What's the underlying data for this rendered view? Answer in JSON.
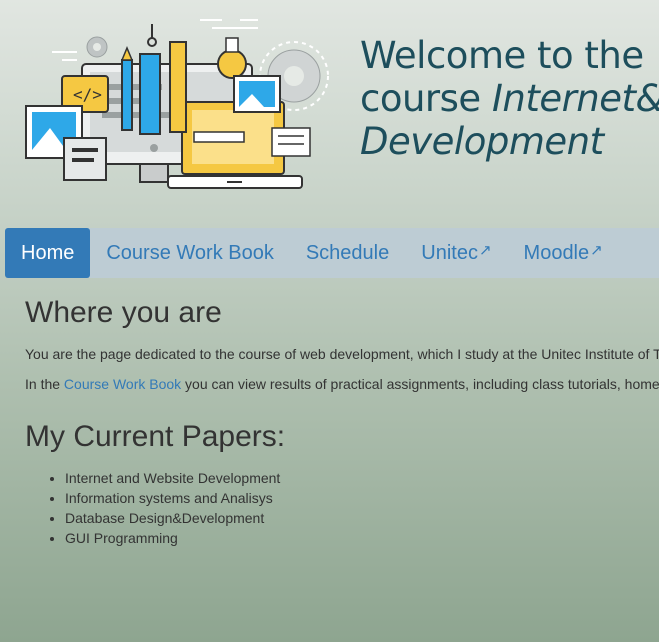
{
  "header": {
    "title_line1": "Welcome to the",
    "title_line2_plain": "course ",
    "title_line2_italic": "Internet&",
    "title_line3_italic": "Development",
    "illustration_icon": "web-development-illustration"
  },
  "nav": {
    "items": [
      {
        "label": "Home",
        "active": true
      },
      {
        "label": "Course Work Book"
      },
      {
        "label": "Schedule"
      },
      {
        "label": "Unitec",
        "external_icon": "↗"
      },
      {
        "label": "Moodle",
        "external_icon": "↗"
      }
    ]
  },
  "main": {
    "section1": {
      "heading": "Where you are",
      "para1": "You are the page dedicated to the course of web development, which I study at the Unitec Institute of T",
      "para2_before": "In the ",
      "para2_link": "Course Work Book",
      "para2_after": " you can view results of practical assignments, including class tutorials, home"
    },
    "section2": {
      "heading": "My Current Papers:",
      "papers": [
        "Internet and Website Development",
        "Information systems and Analisys",
        "Database Design&Development",
        "GUI Programming"
      ]
    }
  },
  "colors": {
    "accent": "#337ab7",
    "title": "#1d4e5c",
    "nav_bg": "#bdccd4"
  }
}
